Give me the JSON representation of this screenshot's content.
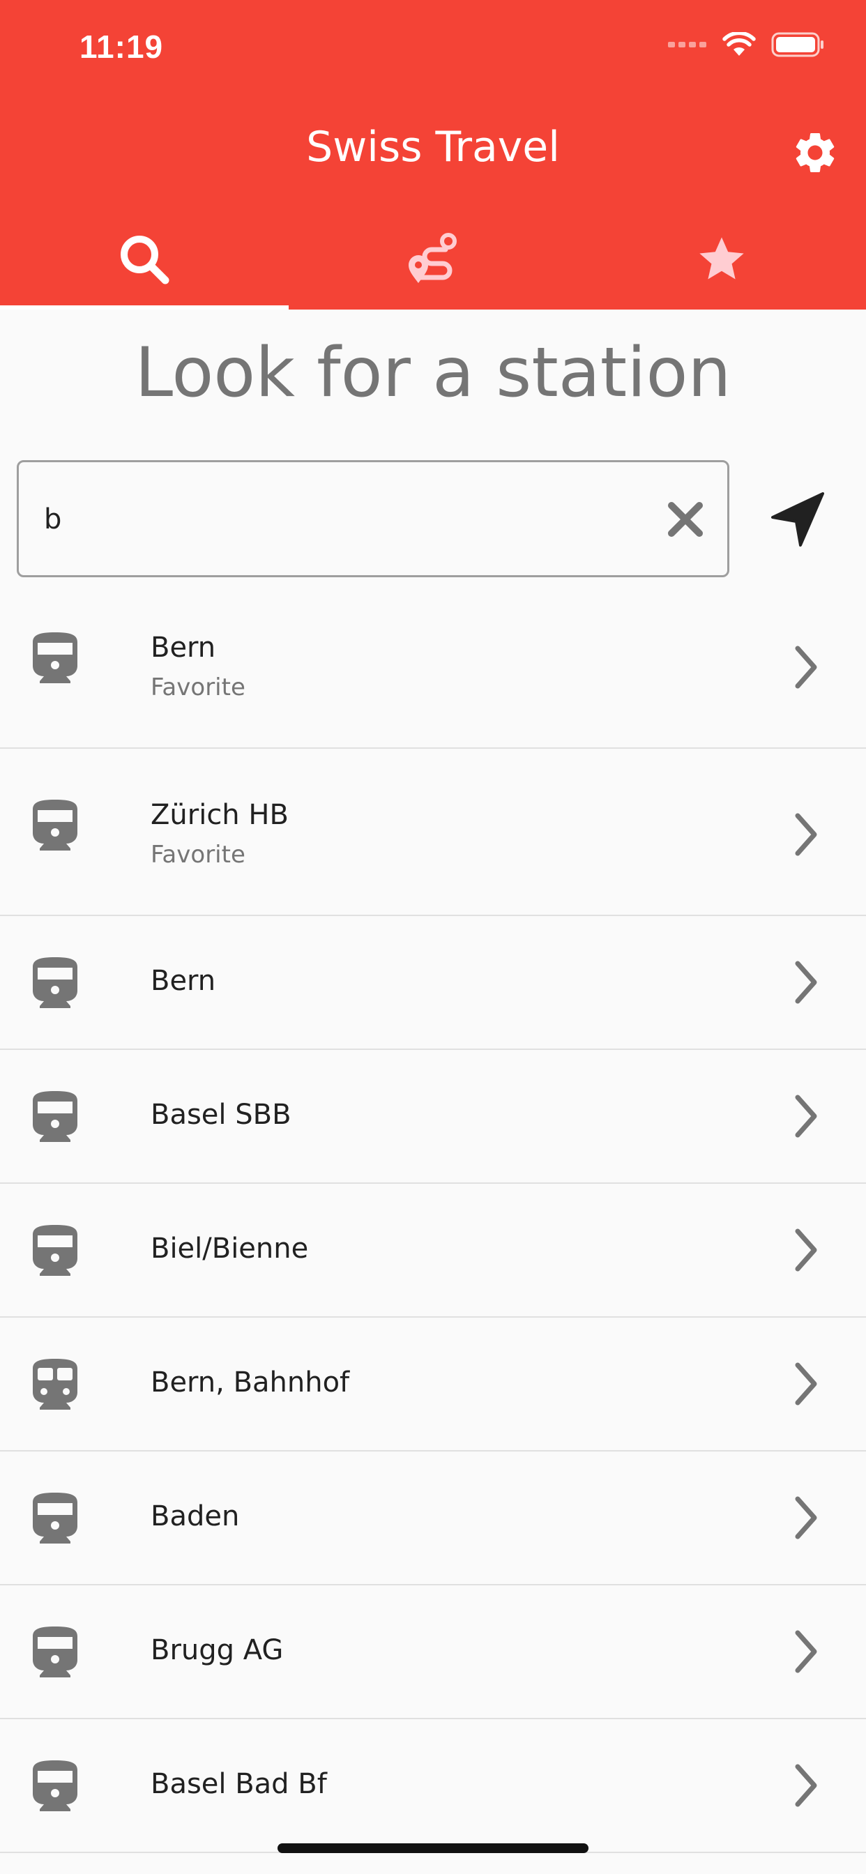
{
  "status_bar": {
    "time": "11:19"
  },
  "header": {
    "title": "Swiss Travel"
  },
  "tabs": [
    {
      "icon": "search-icon",
      "active": true
    },
    {
      "icon": "route-icon",
      "active": false
    },
    {
      "icon": "star-icon",
      "active": false
    }
  ],
  "main": {
    "heading": "Look for a station",
    "search": {
      "value": "b",
      "placeholder": ""
    }
  },
  "stations": [
    {
      "name": "Bern",
      "subtitle": "Favorite",
      "icon": "train-icon"
    },
    {
      "name": "Zürich HB",
      "subtitle": "Favorite",
      "icon": "train-icon"
    },
    {
      "name": "Bern",
      "icon": "train-icon"
    },
    {
      "name": "Basel SBB",
      "icon": "train-icon"
    },
    {
      "name": "Biel/Bienne",
      "icon": "train-icon"
    },
    {
      "name": "Bern, Bahnhof",
      "icon": "tram-icon"
    },
    {
      "name": "Baden",
      "icon": "train-icon"
    },
    {
      "name": "Brugg AG",
      "icon": "train-icon"
    },
    {
      "name": "Basel Bad Bf",
      "icon": "train-icon"
    }
  ],
  "colors": {
    "primary": "#f44336",
    "icon_gray": "#757575",
    "text": "#212121",
    "divider": "#e0e0e0"
  }
}
